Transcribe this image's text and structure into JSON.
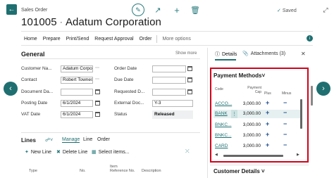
{
  "header": {
    "breadcrumb": "Sales Order",
    "order_no": "101005",
    "separator": "∙",
    "customer": "Adatum Corporation",
    "saved_label": "Saved"
  },
  "actions": [
    "Home",
    "Prepare",
    "Print/Send",
    "Request Approval",
    "Order"
  ],
  "more_options": "More options",
  "general": {
    "title": "General",
    "show_more": "Show more",
    "left_fields": [
      {
        "label": "Customer Na...",
        "value": "Adatum Corpora"
      },
      {
        "label": "Contact",
        "value": "Robert Townes"
      },
      {
        "label": "Document Da...",
        "value": ""
      },
      {
        "label": "Posting Date",
        "value": "6/1/2024"
      },
      {
        "label": "VAT Date",
        "value": "6/1/2024"
      }
    ],
    "right_fields": [
      {
        "label": "Order Date",
        "value": ""
      },
      {
        "label": "Due Date",
        "value": ""
      },
      {
        "label": "Requested D...",
        "value": ""
      },
      {
        "label": "External Doc...",
        "value": "Y-3"
      },
      {
        "label": "Status",
        "value": "Released"
      }
    ]
  },
  "lines": {
    "title": "Lines",
    "tabs": [
      "Manage",
      "Line",
      "Order"
    ],
    "actions": [
      "New Line",
      "Delete Line",
      "Select items..."
    ],
    "columns": [
      "Type",
      "No.",
      "Item Reference No.",
      "Description"
    ]
  },
  "factbox": {
    "tabs": [
      "Details",
      "Attachments (3)"
    ],
    "payment_methods": {
      "title": "Payment Methods",
      "headers": {
        "code": "Code",
        "cap": "Payment Cap",
        "plus": "Plus",
        "minus": "Minus"
      },
      "rows": [
        {
          "code": "ACCO...",
          "cap": "3,000.00"
        },
        {
          "code": "BANK",
          "cap": "3,000.00"
        },
        {
          "code": "BNKC...",
          "cap": "3,000.00"
        },
        {
          "code": "BNKC...",
          "cap": "3,000.00"
        },
        {
          "code": "CARD",
          "cap": "3,000.00"
        }
      ],
      "plus": "+",
      "minus": "−"
    },
    "customer_details": "Customer Details"
  },
  "colors": {
    "accent": "#1f6f71",
    "highlight": "#d0021b"
  }
}
